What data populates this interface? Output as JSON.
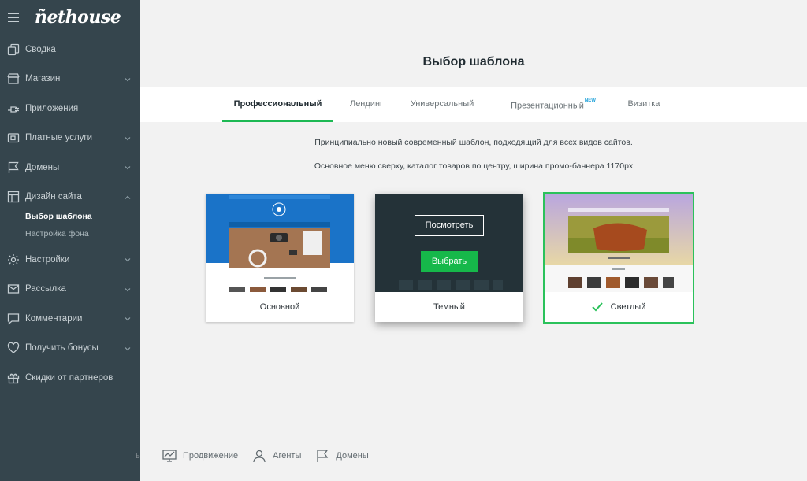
{
  "app": {
    "logo_text": "ñethouse"
  },
  "sidebar": {
    "items": [
      {
        "label": "Сводка",
        "icon": "copy-icon",
        "has_chevron": false
      },
      {
        "label": "Магазин",
        "icon": "shop-icon",
        "has_chevron": true
      },
      {
        "label": "Приложения",
        "icon": "plug-icon",
        "has_chevron": false
      },
      {
        "label": "Платные услуги",
        "icon": "wallet-icon",
        "has_chevron": true
      },
      {
        "label": "Домены",
        "icon": "flag-icon",
        "has_chevron": true
      },
      {
        "label": "Дизайн сайта",
        "icon": "layout-icon",
        "has_chevron": true,
        "expanded": true
      },
      {
        "label": "Настройки",
        "icon": "gear-icon",
        "has_chevron": true
      },
      {
        "label": "Рассылка",
        "icon": "envelope-icon",
        "has_chevron": true
      },
      {
        "label": "Комментарии",
        "icon": "comment-icon",
        "has_chevron": true
      },
      {
        "label": "Получить бонусы",
        "icon": "heart-icon",
        "has_chevron": true
      },
      {
        "label": "Скидки от партнеров",
        "icon": "gift-icon",
        "has_chevron": false
      }
    ],
    "design_subitems": [
      {
        "label": "Выбор шаблона",
        "active": true
      },
      {
        "label": "Настройка фона",
        "active": false
      }
    ]
  },
  "main": {
    "title": "Выбор шаблона",
    "tabs": [
      {
        "label": "Профессиональный",
        "active": true
      },
      {
        "label": "Лендинг",
        "active": false
      },
      {
        "label": "Универсальный",
        "active": false
      },
      {
        "label": "Презентационный",
        "badge": "NEW",
        "active": false
      },
      {
        "label": "Визитка",
        "active": false
      }
    ],
    "description_1": "Принципиально новый современный шаблон, подходящий для всех видов сайтов.",
    "description_2": "Основное меню сверху, каталог товаров по центру, ширина промо-баннера 1170px",
    "templates": [
      {
        "name": "Основной",
        "selected": false
      },
      {
        "name": "Темный",
        "selected": false,
        "view_button": "Посмотреть",
        "choose_button": "Выбрать"
      },
      {
        "name": "Светлый",
        "selected": true
      }
    ]
  },
  "footer": {
    "cut_text": "ь",
    "items": [
      {
        "label": "Продвижение",
        "icon": "chart-monitor-icon"
      },
      {
        "label": "Агенты",
        "icon": "user-icon"
      },
      {
        "label": "Домены",
        "icon": "flag-icon"
      }
    ]
  },
  "colors": {
    "sidebar_bg": "#35454d",
    "accent_green": "#1db954",
    "selected_outline": "#2bc25b",
    "new_badge": "#1a9fd8"
  }
}
